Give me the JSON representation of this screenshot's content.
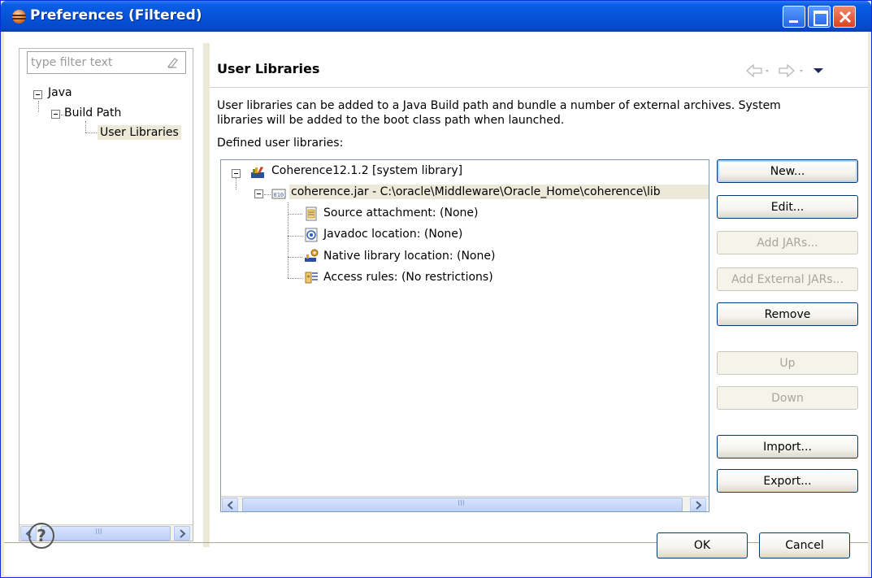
{
  "window": {
    "title": "Preferences (Filtered)"
  },
  "filter": {
    "placeholder": "type filter text"
  },
  "nav_tree": {
    "java": "Java",
    "build_path": "Build Path",
    "user_libraries": "User Libraries"
  },
  "pane": {
    "title": "User Libraries",
    "description_line1": "User libraries can be added to a Java Build path and bundle a number of external archives. System",
    "description_line2": "libraries will be added to the boot class path when launched.",
    "defined_label": "Defined user libraries:"
  },
  "library_tree": {
    "library": "Coherence12.1.2 [system library]",
    "jar": "coherence.jar - C:\\oracle\\Middleware\\Oracle_Home\\coherence\\lib",
    "source": "Source attachment: (None)",
    "javadoc": "Javadoc location: (None)",
    "native": "Native library location: (None)",
    "access": "Access rules: (No restrictions)"
  },
  "buttons": {
    "new": "New...",
    "edit": "Edit...",
    "add_jars": "Add JARs...",
    "add_external_jars": "Add External JARs...",
    "remove": "Remove",
    "up": "Up",
    "down": "Down",
    "import": "Import...",
    "export": "Export..."
  },
  "dialog": {
    "ok": "OK",
    "cancel": "Cancel",
    "help": "?"
  },
  "scroll_grip": "III",
  "colors": {
    "titlebar": "#0653d9",
    "selection": "#ece9d8",
    "border": "#7f9db9"
  }
}
